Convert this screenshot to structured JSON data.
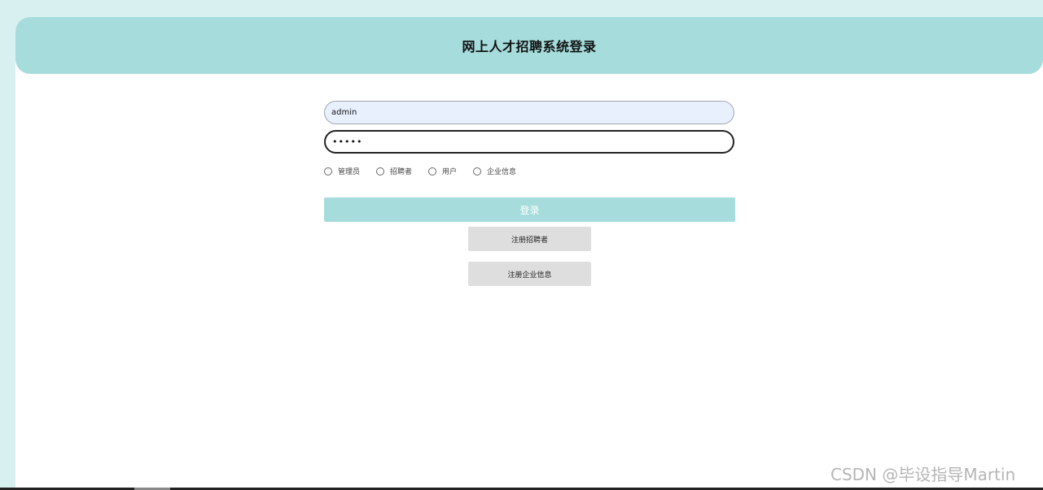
{
  "header": {
    "title": "网上人才招聘系统登录"
  },
  "form": {
    "username_value": "admin",
    "password_value": "•••••",
    "roles": [
      {
        "label": "管理员"
      },
      {
        "label": "招聘者"
      },
      {
        "label": "用户"
      },
      {
        "label": "企业信息"
      }
    ],
    "login_label": "登录",
    "register_recruiter_label": "注册招聘者",
    "register_company_label": "注册企业信息"
  },
  "watermark": "CSDN @毕设指导Martin",
  "colors": {
    "accent": "#a6dcdc",
    "page_bg": "#d9f0f0",
    "secondary_button": "#dedede",
    "input_autofill": "#e8f0fe"
  }
}
